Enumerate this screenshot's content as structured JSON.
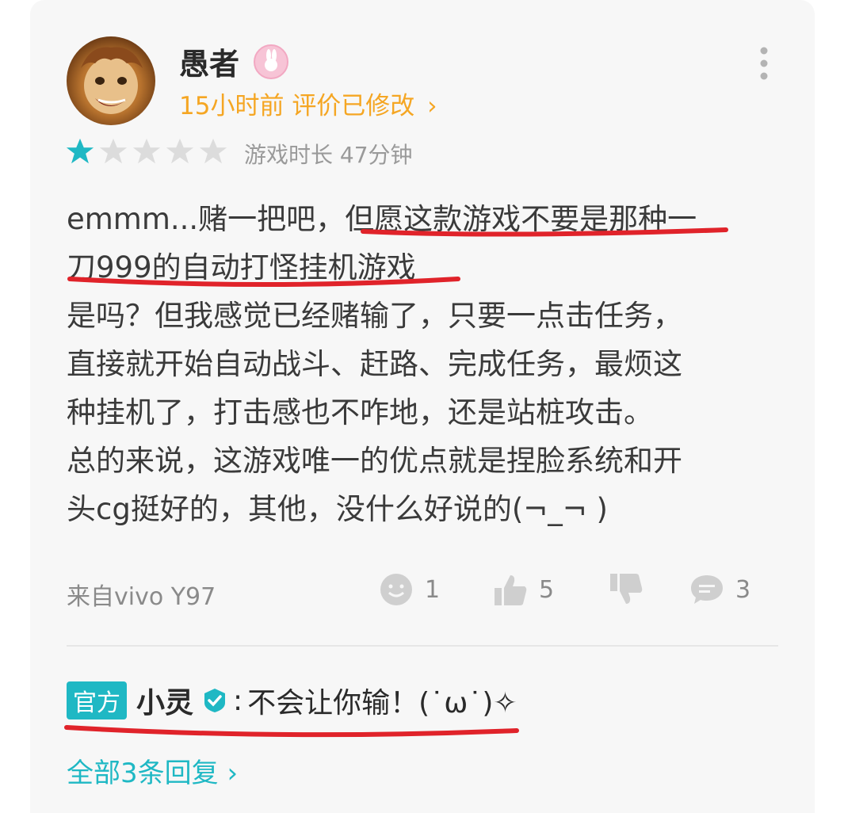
{
  "user": {
    "name": "愚者",
    "time_ago": "15小时前",
    "edited_label": "评价已修改",
    "chevron": "›"
  },
  "rating": {
    "stars_filled": 1,
    "stars_total": 5
  },
  "playtime_label": "游戏时长 47分钟",
  "review": {
    "lines": [
      "emmm...赌一把吧，但愿这款游戏不要是那种一",
      "刀999的自动打怪挂机游戏",
      "是吗？但我感觉已经赌输了，只要一点击任务，",
      "直接就开始自动战斗、赶路、完成任务，最烦这",
      "种挂机了，打击感也不咋地，还是站桩攻击。",
      "总的来说，这游戏唯一的优点就是捏脸系统和开",
      "头cg挺好的，其他，没什么好说的(¬_¬ )"
    ]
  },
  "footer": {
    "device": "来自vivo Y97",
    "emoji_count": "1",
    "like_count": "5",
    "comment_count": "3"
  },
  "official_reply": {
    "tag": "官方",
    "name": "小灵",
    "separator": ":",
    "text": "不会让你输！(˙ω˙)✧"
  },
  "all_replies": "全部3条回复",
  "colors": {
    "accent_orange": "#f5a623",
    "accent_teal": "#1fb8c4",
    "star_filled": "#1fb8c4",
    "star_empty": "#dcdcdc",
    "markup_red": "#e0232a"
  }
}
